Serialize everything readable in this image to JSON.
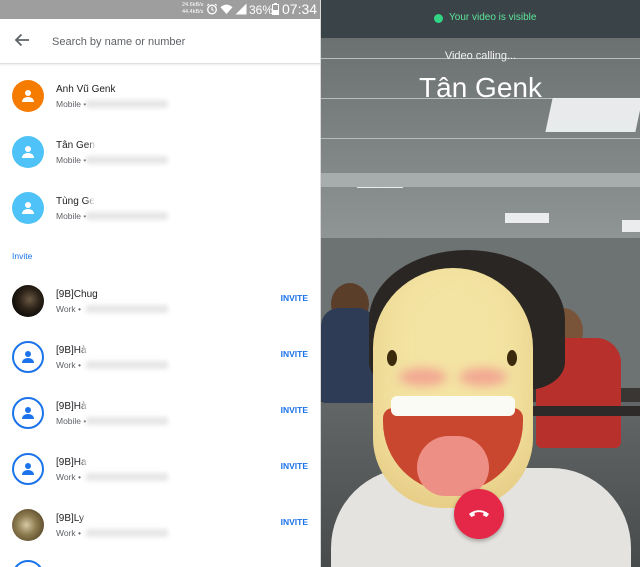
{
  "status_bar": {
    "net_up": "24.6kB/s",
    "net_down": "44.4kB/s",
    "battery": "36%",
    "time": "07:34"
  },
  "search": {
    "placeholder": "Search by name or number"
  },
  "contacts": [
    {
      "name": "Anh Vũ Genk",
      "type": "Mobile",
      "avatar_color": "#f57c00"
    },
    {
      "name": "Tân Gen",
      "type": "Mobile",
      "avatar_color": "#4fc3f7"
    },
    {
      "name": "Tùng Ge",
      "type": "Mobile",
      "avatar_color": "#4fc3f7"
    }
  ],
  "invite_section": {
    "header": "Invite",
    "items": [
      {
        "name": "[9B]Chug",
        "type": "Work",
        "action": "INVITE"
      },
      {
        "name": "[9B]Hà",
        "type": "Work",
        "action": "INVITE"
      },
      {
        "name": "[9B]Hà",
        "type": "Mobile",
        "action": "INVITE"
      },
      {
        "name": "[9B]Ha",
        "type": "Work",
        "action": "INVITE"
      },
      {
        "name": "[9B]Ly",
        "type": "Work",
        "action": "INVITE"
      }
    ]
  },
  "call": {
    "visibility_status": "Your video is visible",
    "status": "Video calling...",
    "callee": "Tân Genk"
  },
  "colors": {
    "accent": "#1a73e8",
    "end_call": "#e52848",
    "visible_indicator": "#32d583"
  }
}
